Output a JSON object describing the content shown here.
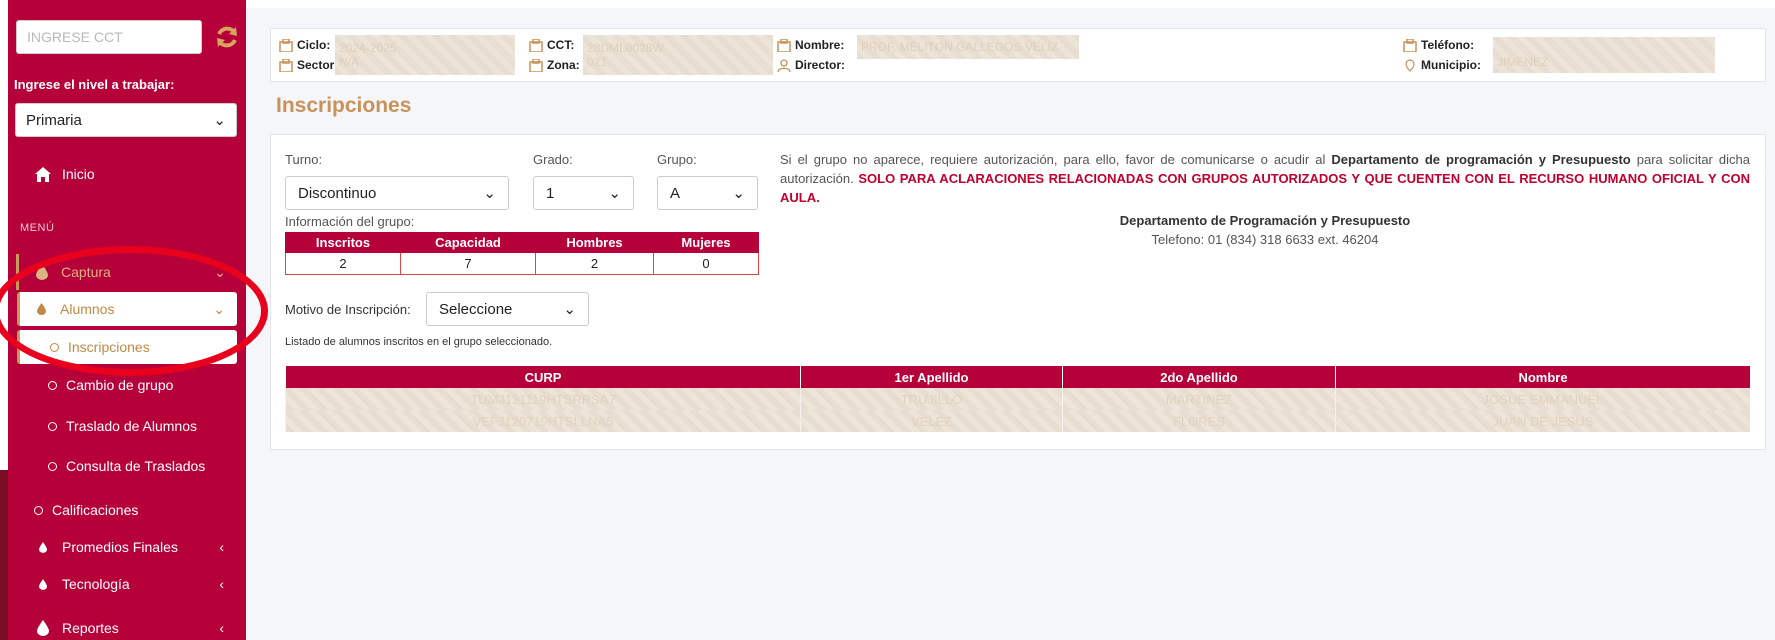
{
  "sidebar": {
    "cct_placeholder": "INGRESE CCT",
    "nivel_label": "Ingrese el nivel a trabajar:",
    "nivel_value": "Primaria",
    "inicio": "Inicio",
    "menu_label": "MENÚ",
    "captura": "Captura",
    "alumnos": "Alumnos",
    "inscripciones": "Inscripciones",
    "cambio_grupo": "Cambio de grupo",
    "traslado": "Traslado de Alumnos",
    "consulta_traslados": "Consulta de Traslados",
    "calificaciones": "Calificaciones",
    "promedios": "Promedios Finales",
    "tecnologia": "Tecnología",
    "reportes": "Reportes"
  },
  "info": {
    "ciclo_label": "Ciclo:",
    "ciclo_value": "2024-2025",
    "sector_label": "Sector:",
    "sector_value": "N/A",
    "cct_label": "CCT:",
    "cct_value": "28DML0028W",
    "zona_label": "Zona:",
    "zona_value": "021",
    "nombre_label": "Nombre:",
    "nombre_value": "PROF. MELITON GALLEGOS VELIZ",
    "director_label": "Director:",
    "telefono_label": "Teléfono:",
    "municipio_label": "Municipio:",
    "municipio_value": "JIMENEZ"
  },
  "page_title": "Inscripciones",
  "form": {
    "turno_label": "Turno:",
    "turno_value": "Discontinuo",
    "grado_label": "Grado:",
    "grado_value": "1",
    "grupo_label": "Grupo:",
    "grupo_value": "A",
    "info_grupo_label": "Información del grupo:",
    "motivo_label": "Motivo de Inscripción:",
    "motivo_value": "Seleccione"
  },
  "group_table": {
    "headers": [
      "Inscritos",
      "Capacidad",
      "Hombres",
      "Mujeres"
    ],
    "values": [
      "2",
      "7",
      "2",
      "0"
    ]
  },
  "notice": {
    "text1": "Si el grupo no aparece, requiere autorización, para ello, favor de comunicarse o acudir al",
    "dept_bold": "Departamento de programación y Presupuesto",
    "text2": "para solicitar dicha autorización.",
    "red": "SOLO PARA ACLARACIONES RELACIONADAS CON GRUPOS AUTORIZADOS Y QUE CUENTEN CON EL RECURSO HUMANO OFICIAL Y CON AULA.",
    "dept_title": "Departamento de Programación y Presupuesto",
    "dept_phone": "Telefono: 01 (834) 318 6633 ext. 46204"
  },
  "listado_text": "Listado de alumnos inscritos en el grupo seleccionado.",
  "students_table": {
    "headers": [
      "CURP",
      "1er Apellido",
      "2do Apellido",
      "Nombre"
    ],
    "rows": [
      [
        "TUMJ121119HTSRRSA7",
        "TRUJILLO",
        "MARTINEZ",
        "JOSUE EMMANUEL"
      ],
      [
        "VEFJ120719HTSLLNA5",
        "VELEZ",
        "FLORES",
        "JUAN DE JESUS"
      ]
    ]
  },
  "colors": {
    "primary": "#b5003a",
    "gold": "#c8925a",
    "highlight_ring": "#e8001c"
  }
}
